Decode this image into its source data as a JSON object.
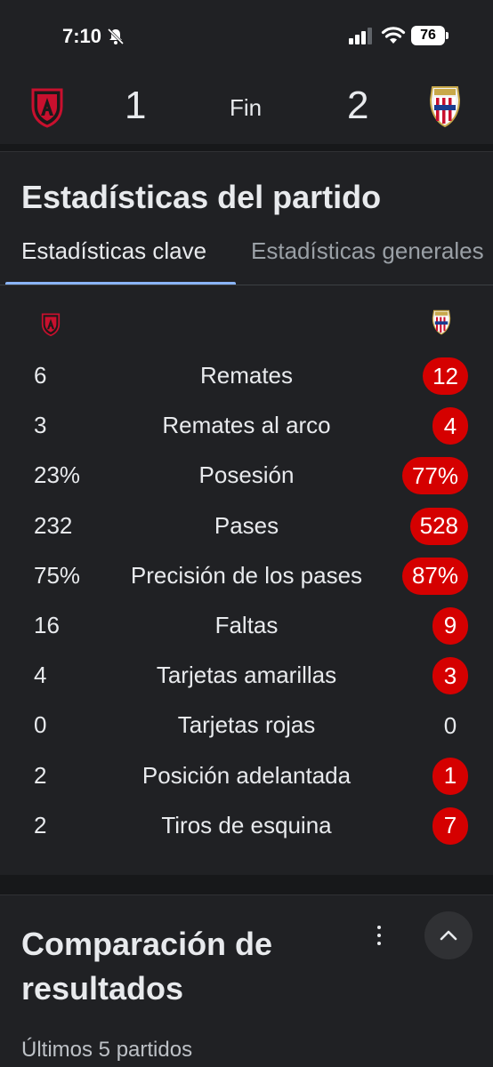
{
  "status_bar": {
    "time": "7:10",
    "battery": "76"
  },
  "match": {
    "home_score": "1",
    "away_score": "2",
    "status": "Fin"
  },
  "stats_card": {
    "title": "Estadísticas del partido",
    "tabs": [
      {
        "label": "Estadísticas clave",
        "selected": true
      },
      {
        "label": "Estadísticas generales",
        "selected": false
      }
    ],
    "rows": [
      {
        "label": "Remates",
        "home": "6",
        "away": "12",
        "away_leads": true
      },
      {
        "label": "Remates al arco",
        "home": "3",
        "away": "4",
        "away_leads": true
      },
      {
        "label": "Posesión",
        "home": "23%",
        "away": "77%",
        "away_leads": true
      },
      {
        "label": "Pases",
        "home": "232",
        "away": "528",
        "away_leads": true
      },
      {
        "label": "Precisión de los pases",
        "home": "75%",
        "away": "87%",
        "away_leads": true
      },
      {
        "label": "Faltas",
        "home": "16",
        "away": "9",
        "away_leads": true
      },
      {
        "label": "Tarjetas amarillas",
        "home": "4",
        "away": "3",
        "away_leads": true
      },
      {
        "label": "Tarjetas rojas",
        "home": "0",
        "away": "0",
        "away_leads": false
      },
      {
        "label": "Posición adelantada",
        "home": "2",
        "away": "1",
        "away_leads": true
      },
      {
        "label": "Tiros de esquina",
        "home": "2",
        "away": "7",
        "away_leads": true
      }
    ]
  },
  "comparison_card": {
    "title": "Comparación de resultados",
    "subtitle": "Últimos 5 partidos"
  },
  "colors": {
    "background": "#202124",
    "highlight": "#d50000",
    "tab_indicator": "#8ab4f8",
    "home_crest": "#c8102e",
    "away_crest": "#c8102e"
  },
  "icons": {
    "home_crest": "atlas-crest-icon",
    "away_crest": "chivas-crest-icon",
    "menu": "more-vert-icon",
    "collapse": "chevron-up-icon"
  }
}
